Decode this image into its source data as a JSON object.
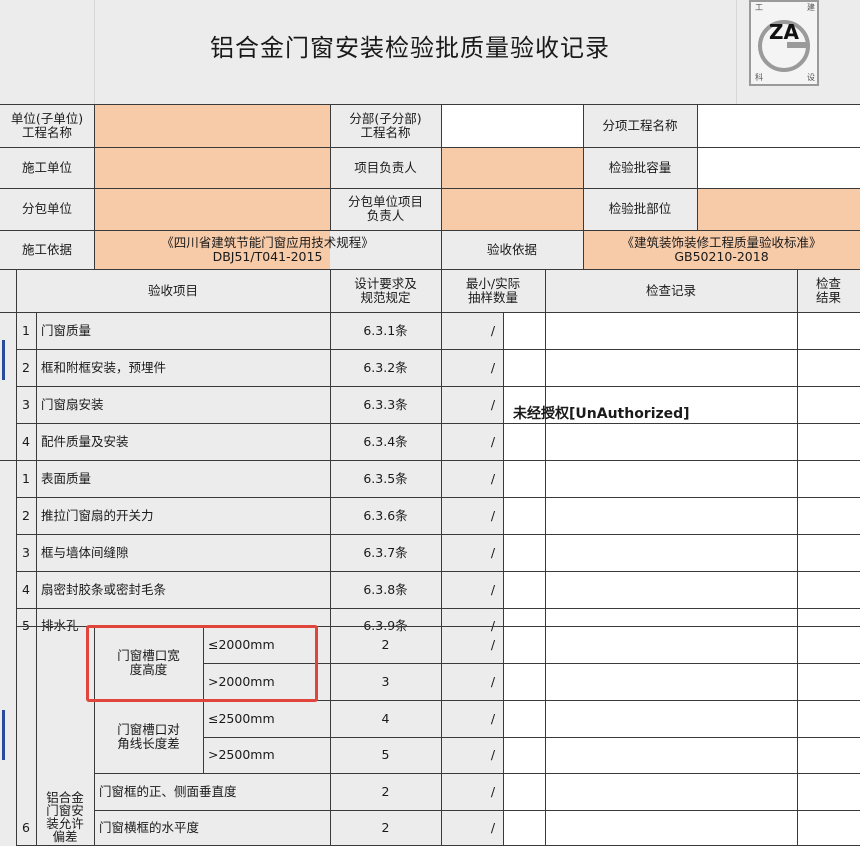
{
  "title": "铝合金门窗安装检验批质量验收记录",
  "logo": {
    "main": "ZA",
    "tl": "工",
    "tr": "建",
    "bl": "科",
    "br": "设"
  },
  "header": {
    "unit_label": "单位(子单位)\n工程名称",
    "dept_label": "分部(子分部)\n工程名称",
    "item_name_label": "分项工程名称",
    "construction_unit_label": "施工单位",
    "project_lead_label": "项目负责人",
    "batch_capacity_label": "检验批容量",
    "subcontract_label": "分包单位",
    "sub_lead_label": "分包单位项目\n负责人",
    "batch_part_label": "检验批部位",
    "basis_label": "施工依据",
    "basis_value": "《四川省建筑节能门窗应用技术规程》\nDBJ51/T041-2015",
    "accept_basis_label": "验收依据",
    "accept_basis_value": "《建筑装饰装修工程质量验收标准》\nGB50210-2018"
  },
  "columns": {
    "item": "验收项目",
    "design": "设计要求及\n规范规定",
    "sample": "最小/实际\n抽样数量",
    "record": "检查记录",
    "result": "检查\n结果"
  },
  "main_items": [
    {
      "no": "1",
      "name": "门窗质量",
      "spec": "6.3.1条"
    },
    {
      "no": "2",
      "name": "框和附框安装，预埋件",
      "spec": "6.3.2条"
    },
    {
      "no": "3",
      "name": "门窗扇安装",
      "spec": "6.3.3条"
    },
    {
      "no": "4",
      "name": "配件质量及安装",
      "spec": "6.3.4条"
    }
  ],
  "general_items": [
    {
      "no": "1",
      "name": "表面质量",
      "spec": "6.3.5条"
    },
    {
      "no": "2",
      "name": "推拉门窗扇的开关力",
      "spec": "6.3.6条"
    },
    {
      "no": "3",
      "name": "框与墙体间缝隙",
      "spec": "6.3.7条"
    },
    {
      "no": "4",
      "name": "扇密封胶条或密封毛条",
      "spec": "6.3.8条"
    },
    {
      "no": "5",
      "name": "排水孔",
      "spec": "6.3.9条"
    }
  ],
  "deviation": {
    "no": "6",
    "group_label": "铝合金\n门窗安\n装允许\n偏差",
    "slot_label": "门窗槽口宽\n度高度",
    "slot_rows": [
      {
        "cond": "≤2000mm",
        "value": "2"
      },
      {
        "cond": ">2000mm",
        "value": "3"
      }
    ],
    "diag_label": "门窗槽口对\n角线长度差",
    "diag_rows": [
      {
        "cond": "≤2500mm",
        "value": "4"
      },
      {
        "cond": ">2500mm",
        "value": "5"
      }
    ],
    "vertical_label": "门窗框的正、侧面垂直度",
    "vertical_value": "2",
    "level_label": "门窗横框的水平度",
    "level_value": "2"
  },
  "slash": "/",
  "watermark": "未经授权[UnAuthorized]",
  "colors": {
    "peach": "#f7caa8",
    "gray": "#ececec",
    "highlight": "#e0443a",
    "line": "#3a3a3a"
  }
}
